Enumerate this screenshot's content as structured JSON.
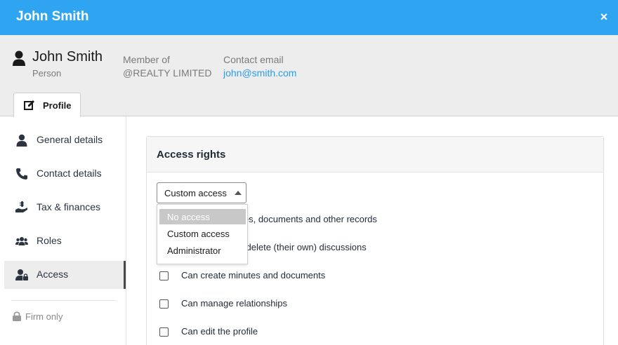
{
  "window": {
    "title": "John Smith",
    "close_label": "×"
  },
  "header": {
    "name": "John Smith",
    "type": "Person",
    "member_label": "Member of",
    "member_value": "@REALTY LIMITED",
    "contact_label": "Contact email",
    "contact_value": "john@smith.com",
    "tab_label": "Profile"
  },
  "sidebar": {
    "items": [
      {
        "label": "General details",
        "icon": "person-icon"
      },
      {
        "label": "Contact details",
        "icon": "phone-icon"
      },
      {
        "label": "Tax & finances",
        "icon": "hand-money-icon"
      },
      {
        "label": "Roles",
        "icon": "group-icon"
      },
      {
        "label": "Access",
        "icon": "user-lock-icon",
        "active": true
      }
    ],
    "footer": "Firm only"
  },
  "panel": {
    "title": "Access rights",
    "select_value": "Custom access",
    "options": [
      "No access",
      "Custom access",
      "Administrator"
    ],
    "highlighted_option": "No access",
    "permissions": [
      "Can view minutes, documents and other records",
      "Can create and delete (their own) discussions",
      "Can create minutes and documents",
      "Can manage relationships",
      "Can edit the profile"
    ]
  },
  "colors": {
    "accent": "#2fa4f0",
    "link": "#2a9ce8"
  }
}
